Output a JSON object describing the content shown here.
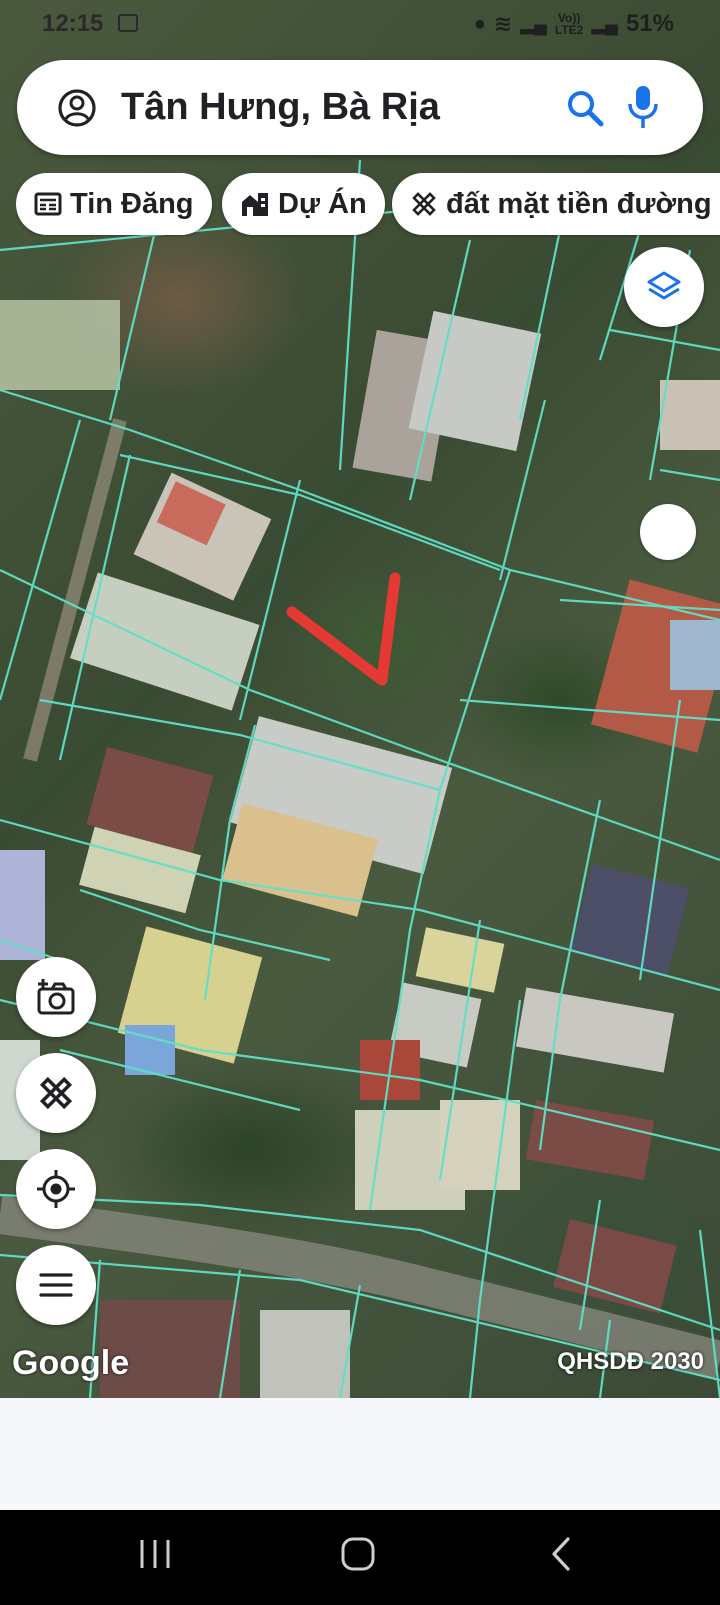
{
  "status_bar": {
    "time": "12:15",
    "network_label_top": "Vo))",
    "network_label_bottom": "LTE2",
    "battery": "51%"
  },
  "search": {
    "query": "Tân Hưng, Bà Rịa"
  },
  "chips": [
    {
      "label": "Tin Đăng",
      "icon": "newspaper-icon"
    },
    {
      "label": "Dự Án",
      "icon": "buildings-icon"
    },
    {
      "label": "đất mặt tiền đường s",
      "icon": "ruler-pencil-icon"
    }
  ],
  "map": {
    "attribution": "Google",
    "plan_label": "QHSDĐ 2030",
    "parcel_line_color": "#5fe0c6",
    "marker_color": "#e53935"
  },
  "accent_color": "#1a73e8"
}
